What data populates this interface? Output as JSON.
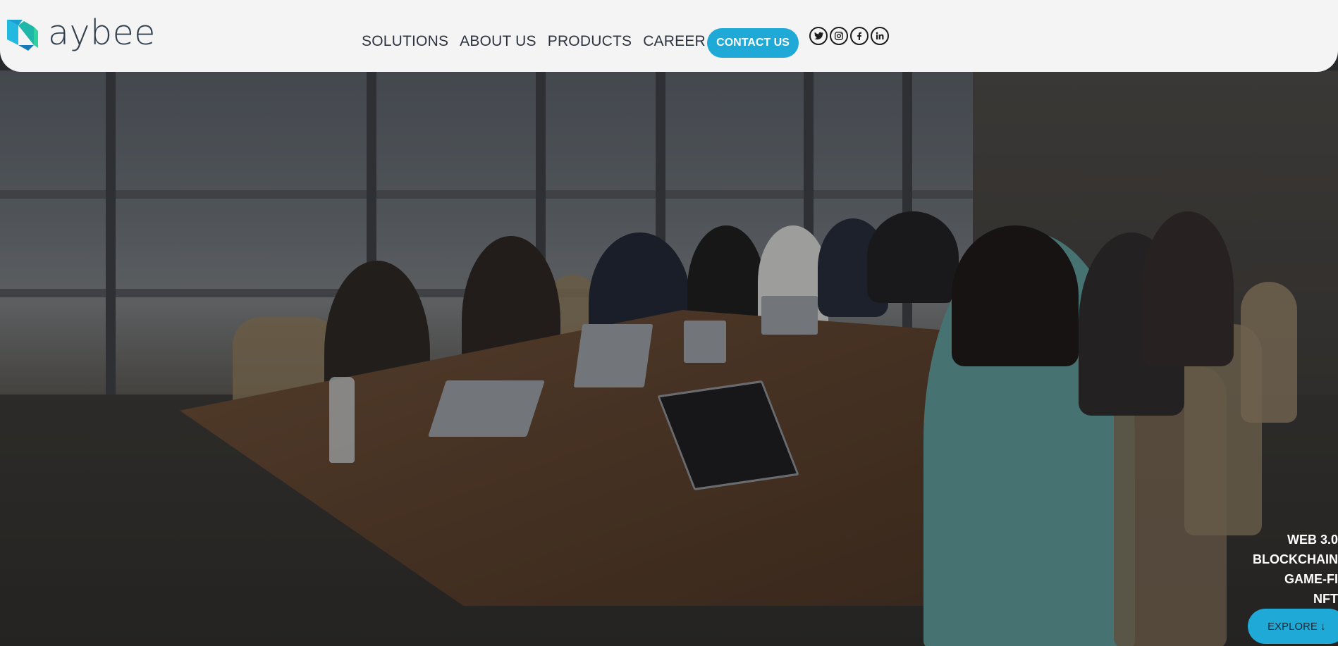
{
  "brand": {
    "logo_text": "aybee",
    "accent": "#1fa9d6"
  },
  "nav": {
    "items": [
      {
        "label": "SOLUTIONS"
      },
      {
        "label": "ABOUT US"
      },
      {
        "label": "PRODUCTS"
      },
      {
        "label": "CAREER"
      }
    ],
    "contact_label": "CONTACT US"
  },
  "socials": [
    {
      "name": "twitter-icon"
    },
    {
      "name": "instagram-icon"
    },
    {
      "name": "facebook-icon"
    },
    {
      "name": "linkedin-icon"
    }
  ],
  "hero": {
    "tags": [
      "WEB 3.0",
      "BLOCKCHAIN",
      "GAME-FI",
      "NFT"
    ],
    "explore_label": "EXPLORE ↓"
  }
}
